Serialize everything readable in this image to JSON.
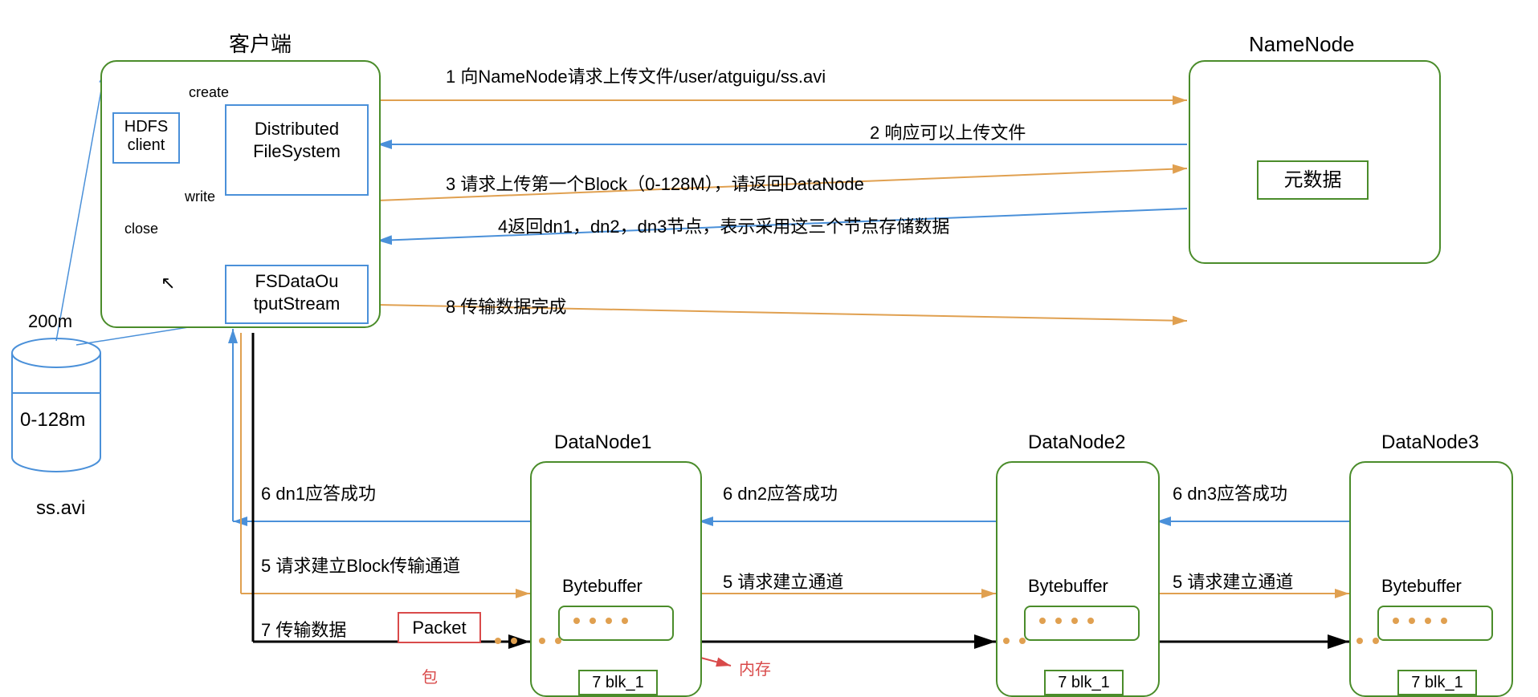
{
  "title_client": "客户端",
  "title_namenode": "NameNode",
  "title_dn1": "DataNode1",
  "title_dn2": "DataNode2",
  "title_dn3": "DataNode3",
  "hdfs_client": "HDFS\nclient",
  "distributed_fs": "Distributed FileSystem",
  "fs_out": "FSDataOu tputStream",
  "metadata": "元数据",
  "bytebuffer": "Bytebuffer",
  "blk": "7 blk_1",
  "packet": "Packet",
  "create": "create",
  "write": "write",
  "close": "close",
  "file_size": "200m",
  "file_part": "0-128m",
  "file_name": "ss.avi",
  "msg1": "1 向NameNode请求上传文件/user/atguigu/ss.avi",
  "msg2": "2 响应可以上传文件",
  "msg3": "3 请求上传第一个Block（0-128M），请返回DataNode",
  "msg4": "4返回dn1，dn2，dn3节点，表示采用这三个节点存储数据",
  "msg5": "5 请求建立Block传输通道",
  "msg5b": "5 请求建立通道",
  "msg6a": "6 dn1应答成功",
  "msg6b": "6 dn2应答成功",
  "msg6c": "6 dn3应答成功",
  "msg7": "7 传输数据",
  "msg8": "8 传输数据完成",
  "anno_packet": "包",
  "anno_mem": "内存"
}
